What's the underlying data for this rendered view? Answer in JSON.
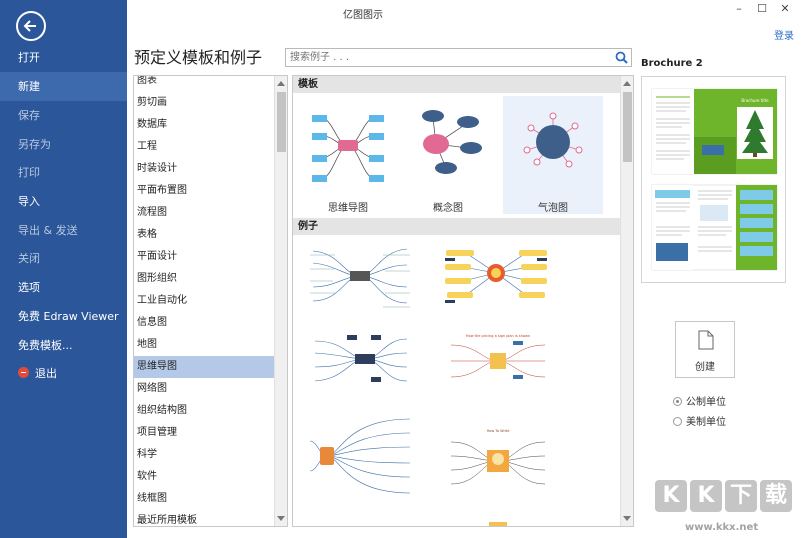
{
  "window": {
    "title": "亿图图示",
    "login": "登录"
  },
  "nav": {
    "items": [
      {
        "label": "打开",
        "state": "normal"
      },
      {
        "label": "新建",
        "state": "active"
      },
      {
        "label": "保存",
        "state": "dim"
      },
      {
        "label": "另存为",
        "state": "dim"
      },
      {
        "label": "打印",
        "state": "dim"
      },
      {
        "label": "导入",
        "state": "normal"
      },
      {
        "label": "导出 & 发送",
        "state": "dim"
      },
      {
        "label": "关闭",
        "state": "dim"
      },
      {
        "label": "选项",
        "state": "normal"
      },
      {
        "label": "免费 Edraw Viewer",
        "state": "normal"
      },
      {
        "label": "免费模板...",
        "state": "normal"
      },
      {
        "label": "退出",
        "state": "normal"
      }
    ]
  },
  "header": {
    "title": "预定义模板和例子"
  },
  "search": {
    "placeholder": "搜索例子 . . ."
  },
  "categories": {
    "items": [
      "图表",
      "剪切画",
      "数据库",
      "工程",
      "时装设计",
      "平面布置图",
      "流程图",
      "表格",
      "平面设计",
      "图形组织",
      "工业自动化",
      "信息图",
      "地图",
      "思维导图",
      "网络图",
      "组织结构图",
      "项目管理",
      "科学",
      "软件",
      "线框图",
      "最近所用模板"
    ],
    "selected": "思维导图"
  },
  "gallery": {
    "templates_heading": "模板",
    "templates": [
      {
        "label": "思维导图",
        "icon": "mindmap-thumbnail"
      },
      {
        "label": "概念图",
        "icon": "concept-map-thumbnail"
      },
      {
        "label": "气泡图",
        "icon": "bubble-chart-thumbnail"
      }
    ],
    "selected_template": "气泡图",
    "examples_heading": "例子",
    "example_titles": [
      "How the pricing a sign plan is shown",
      "How To Write"
    ]
  },
  "preview": {
    "title": "Brochure 2",
    "brochure_heading": "Brochure title"
  },
  "create": {
    "label": "创建"
  },
  "units": {
    "options": [
      "公制单位",
      "美制单位"
    ],
    "selected": "公制单位"
  },
  "watermark": {
    "letters": [
      "K",
      "K",
      "下",
      "载"
    ],
    "url": "www.kkx.net"
  },
  "colors": {
    "nav_bg": "#2b579a",
    "accent": "#2b6cc4",
    "selection": "#b4c8e8",
    "mindmap_blue": "#4b8cc8",
    "concept_pink": "#e06a93",
    "bubble_navy": "#3e5f8a",
    "brochure_green": "#6fb52c"
  }
}
